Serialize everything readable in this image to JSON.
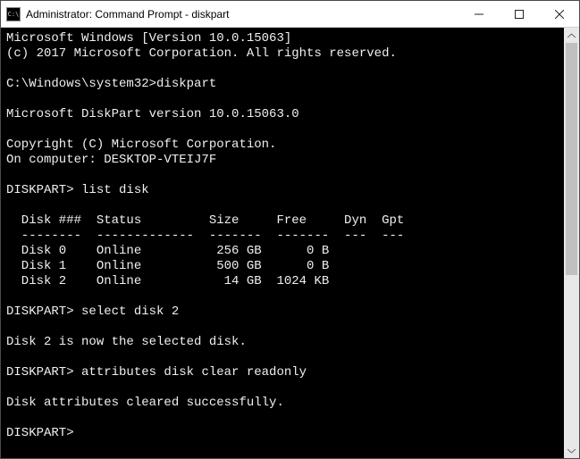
{
  "titlebar": {
    "icon_text": "C:\\",
    "title": "Administrator: Command Prompt - diskpart"
  },
  "terminal": {
    "lines": {
      "ver1": "Microsoft Windows [Version 10.0.15063]",
      "ver2": "(c) 2017 Microsoft Corporation. All rights reserved.",
      "blank": "",
      "prompt_path": "C:\\Windows\\system32>",
      "cmd_diskpart": "diskpart",
      "dp_ver": "Microsoft DiskPart version 10.0.15063.0",
      "dp_copy": "Copyright (C) Microsoft Corporation.",
      "dp_comp": "On computer: DESKTOP-VTEIJ7F",
      "dp_prompt": "DISKPART> ",
      "cmd_list": "list disk",
      "hdr": "  Disk ###  Status         Size     Free     Dyn  Gpt",
      "sep": "  --------  -------------  -------  -------  ---  ---",
      "row0": "  Disk 0    Online          256 GB      0 B        ",
      "row1": "  Disk 1    Online          500 GB      0 B        ",
      "row2": "  Disk 2    Online           14 GB  1024 KB        ",
      "cmd_select": "select disk 2",
      "msg_select": "Disk 2 is now the selected disk.",
      "cmd_attr": "attributes disk clear readonly",
      "msg_attr": "Disk attributes cleared successfully."
    }
  }
}
